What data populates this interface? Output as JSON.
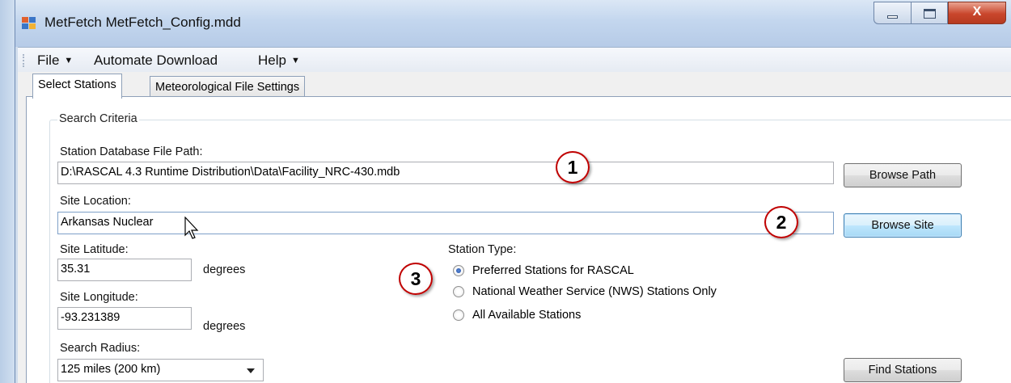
{
  "window": {
    "title": "MetFetch   MetFetch_Config.mdd",
    "close_glyph": "X"
  },
  "menu": {
    "items": [
      {
        "label": "File",
        "has_arrow": true
      },
      {
        "label": "Automate Download",
        "has_arrow": false
      },
      {
        "label": "Help",
        "has_arrow": true
      }
    ],
    "arrow_glyph": "▼"
  },
  "tabs": [
    {
      "label": "Select Stations",
      "active": true
    },
    {
      "label": "Meteorological File Settings",
      "active": false
    }
  ],
  "search_criteria": {
    "legend": "Search Criteria",
    "db_path_label": "Station Database File Path:",
    "db_path_value": "D:\\RASCAL 4.3 Runtime Distribution\\Data\\Facility_NRC-430.mdb",
    "browse_path_label": "Browse Path",
    "site_location_label": "Site Location:",
    "site_location_value": "Arkansas Nuclear",
    "browse_site_label": "Browse Site",
    "site_latitude_label": "Site Latitude:",
    "site_latitude_value": "35.31",
    "site_longitude_label": "Site Longitude:",
    "site_longitude_value": "-93.231389",
    "degrees_label": "degrees",
    "search_radius_label": "Search Radius:",
    "search_radius_value": "125 miles (200 km)",
    "station_type_label": "Station Type:",
    "station_types": [
      {
        "label": "Preferred Stations for RASCAL",
        "checked": true
      },
      {
        "label": "National Weather Service (NWS) Stations Only",
        "checked": false
      },
      {
        "label": "All Available Stations",
        "checked": false
      }
    ],
    "find_stations_label": "Find Stations"
  },
  "callouts": [
    "1",
    "2",
    "3"
  ],
  "colors": {
    "callout_border": "#c00000",
    "default_button_border": "#3c7fb1",
    "close_button": "#c9462c"
  }
}
